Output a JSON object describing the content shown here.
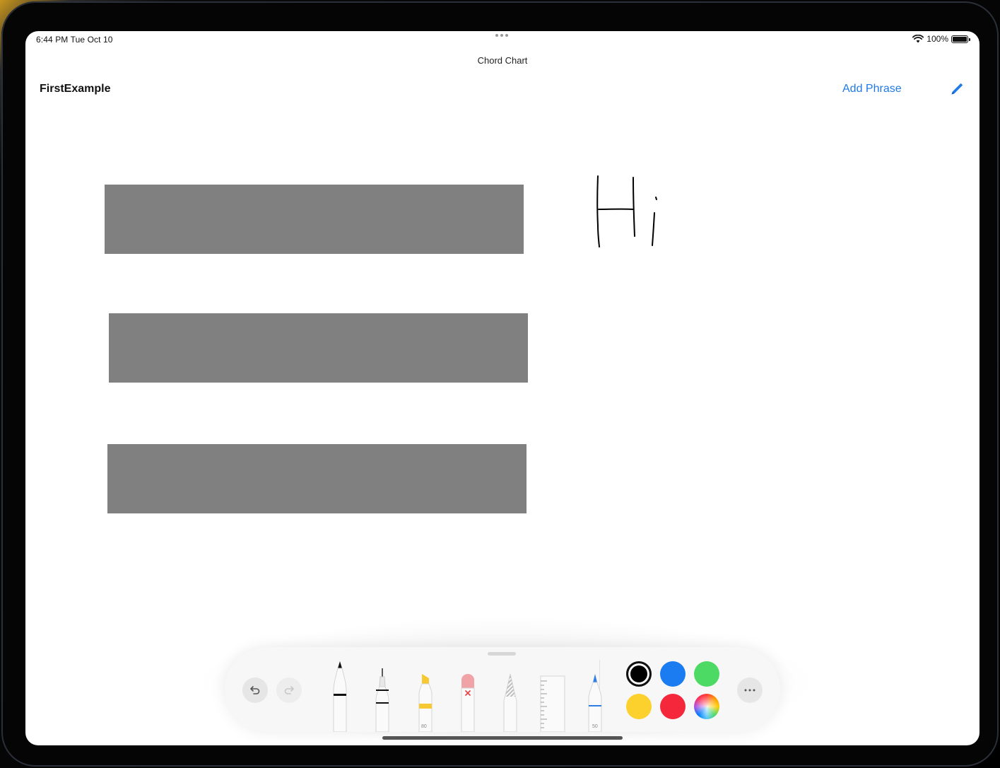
{
  "status_bar": {
    "time": "6:44 PM  Tue Oct 10",
    "battery": "100%"
  },
  "nav": {
    "title": "Chord Chart",
    "document_title": "FirstExample",
    "add_phrase_label": "Add Phrase",
    "edit_icon": "pencil-icon"
  },
  "canvas": {
    "phrase_count": 3,
    "bar_color": "#808080",
    "handwritten_text": "Hi"
  },
  "tool_palette": {
    "tools": [
      "pen",
      "monoline",
      "highlighter",
      "eraser",
      "pencil",
      "ruler",
      "fountain-pen"
    ],
    "tool_numbers": {
      "highlighter": "80",
      "fountain_pen": "50"
    },
    "colors": [
      "#000000",
      "#1a7cf0",
      "#4cd964",
      "#fdd12d",
      "#f5283b",
      "multicolor"
    ],
    "selected_color": "#000000",
    "more_icon": "ellipsis-icon"
  },
  "accent_color": "#1f7ae6"
}
